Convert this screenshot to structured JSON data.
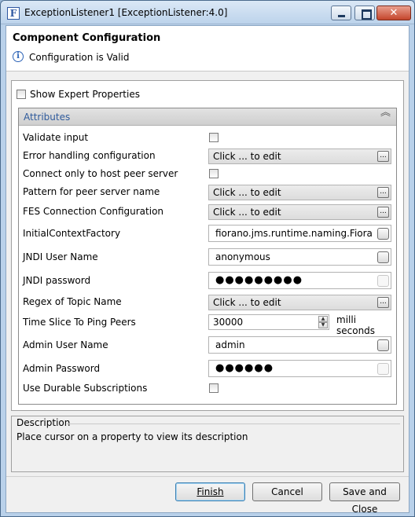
{
  "window": {
    "title": "ExceptionListener1 [ExceptionListener:4.0]",
    "icon_letter": "F",
    "controls": [
      "minimize-icon",
      "maximize-icon",
      "close-icon"
    ]
  },
  "header": {
    "title": "Component Configuration",
    "message": "Configuration is Valid",
    "message_icon": "info-icon"
  },
  "expert": {
    "label": "Show Expert Properties",
    "checked": false
  },
  "attributes": {
    "title": "Attributes",
    "properties": [
      {
        "label": "Validate input",
        "type": "checkbox",
        "checked": false
      },
      {
        "label": "Error handling configuration",
        "type": "editor",
        "value": "Click ... to edit",
        "button": "..."
      },
      {
        "label": "Connect only to host peer server",
        "type": "checkbox",
        "checked": false
      },
      {
        "label": "Pattern for peer server name",
        "type": "editor",
        "value": "Click ... to edit",
        "button": "..."
      },
      {
        "label": "FES Connection Configuration",
        "type": "editor",
        "value": "Click ... to edit",
        "button": "..."
      },
      {
        "label": "InitialContextFactory",
        "type": "text",
        "value": "fiorano.jms.runtime.naming.FioranoIn"
      },
      {
        "label": "JNDI User Name",
        "type": "text",
        "value": "anonymous"
      },
      {
        "label": "JNDI password",
        "type": "password",
        "value": "●●●●●●●●●"
      },
      {
        "label": "Regex of Topic Name",
        "type": "editor",
        "value": "Click ... to edit",
        "button": "..."
      },
      {
        "label": "Time Slice To Ping Peers",
        "type": "spinner",
        "value": "30000",
        "unit": "milli seconds"
      },
      {
        "label": "Admin User Name",
        "type": "text",
        "value": "admin"
      },
      {
        "label": "Admin Password",
        "type": "password",
        "value": "●●●●●●"
      },
      {
        "label": "Use Durable Subscriptions",
        "type": "checkbox",
        "checked": false
      }
    ]
  },
  "description": {
    "title": "Description",
    "text": "Place cursor on a property to view its description"
  },
  "buttons": {
    "finish": "Finish",
    "cancel": "Cancel",
    "save_close": "Save and Close"
  }
}
